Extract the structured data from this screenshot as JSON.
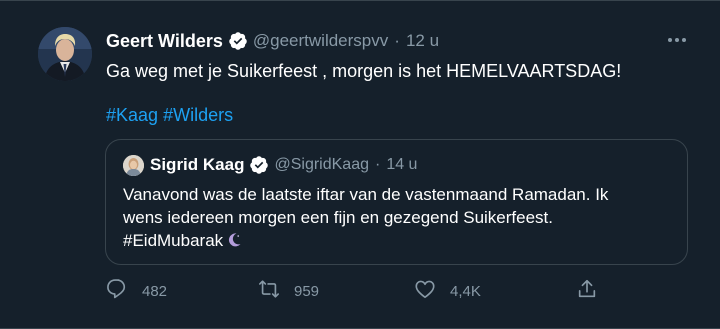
{
  "tweet": {
    "author_name": "Geert Wilders",
    "author_handle": "@geertwilderspvv",
    "separator": "·",
    "time": "12 u",
    "text": "Ga weg met je Suikerfeest , morgen is het HEMELVAARTSDAG!",
    "hashtags": [
      "#Kaag",
      "#Wilders"
    ],
    "verified_icon": "verified-badge-icon",
    "more_icon": "more-horizontal-icon"
  },
  "quote": {
    "author_name": "Sigrid Kaag",
    "author_handle": "@SigridKaag",
    "separator": "·",
    "time": "14 u",
    "text_lines": [
      "Vanavond was de laatste iftar van de vastenmaand Ramadan. Ik",
      "wens iedereen morgen een fijn en gezegend Suikerfeest.",
      "#EidMubarak"
    ],
    "emoji_icon": "crescent-moon-icon"
  },
  "actions": {
    "reply_count": "482",
    "retweet_count": "959",
    "like_count": "4,4K",
    "reply_icon": "reply-icon",
    "retweet_icon": "retweet-icon",
    "like_icon": "heart-icon",
    "share_icon": "share-icon"
  },
  "colors": {
    "background": "#15202b",
    "border": "#38444d",
    "text": "#ffffff",
    "secondary_text": "#8899a6",
    "accent": "#1da1f2",
    "verified": "#ffffff",
    "moon": "#b39ddb"
  }
}
